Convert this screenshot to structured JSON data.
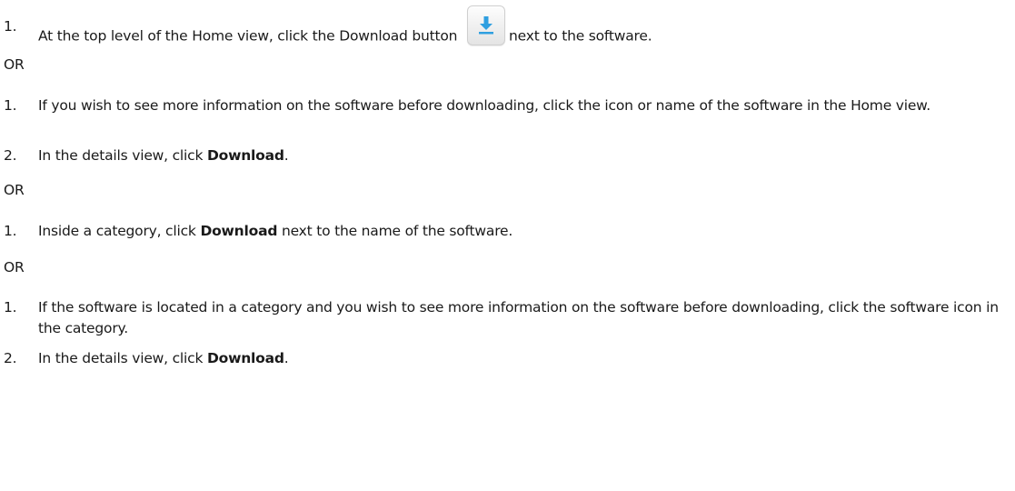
{
  "doc": {
    "option1": {
      "step1": {
        "num": "1.",
        "before_icon": "At the top level of the Home view, click the Download button",
        "icon": "download-arrow-icon",
        "after_icon": "next to the software."
      }
    },
    "or1": "OR",
    "option2": {
      "step1": {
        "num": "1.",
        "text": "If you wish to see more information on the software before downloading, click the icon or name of the software in the Home view."
      },
      "step2": {
        "num": "2.",
        "text_before": "In the details view, click",
        "bold": "Download",
        "text_after": "."
      }
    },
    "or2": "OR",
    "option3": {
      "step1": {
        "num": "1.",
        "text_before": "Inside a category, click",
        "bold": "Download",
        "text_after": "next to the name of the software."
      }
    },
    "or3": "OR",
    "option4": {
      "step1": {
        "num": "1.",
        "text": "If the software is located in a category and you wish to see more information on the software before downloading, click the software icon in the category."
      },
      "step2": {
        "num": "2.",
        "text_before": "In the details view, click",
        "bold": "Download",
        "text_after": "."
      }
    },
    "colors": {
      "text": "#1a1a1a",
      "icon_arrow": "#2f9fe0",
      "icon_bg": "#eeeeee"
    }
  }
}
